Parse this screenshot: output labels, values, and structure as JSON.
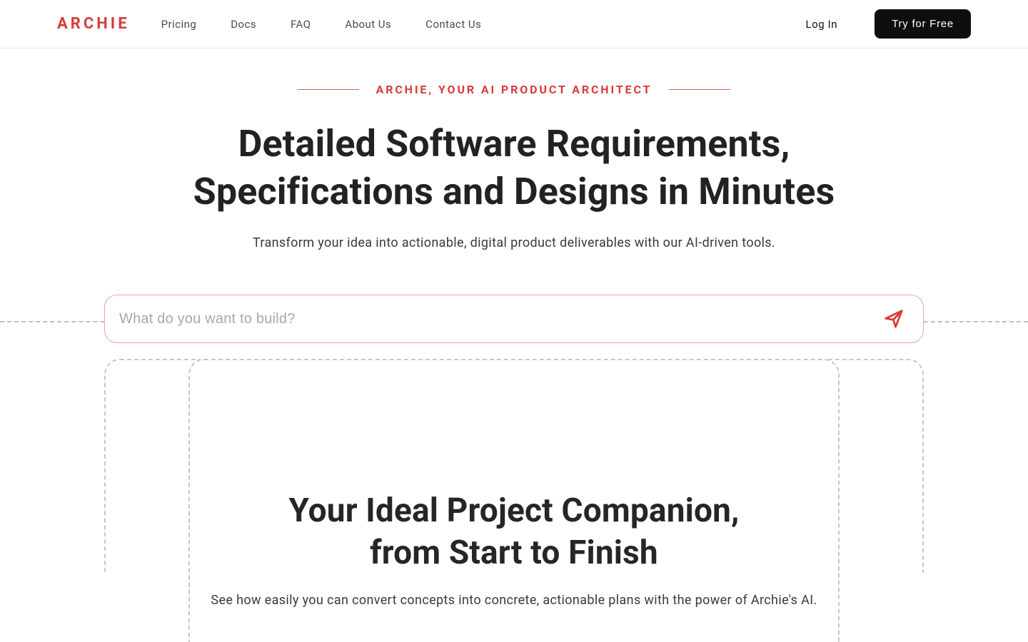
{
  "brand": "ARCHIE",
  "nav": {
    "items": [
      {
        "label": "Pricing"
      },
      {
        "label": "Docs"
      },
      {
        "label": "FAQ"
      },
      {
        "label": "About Us"
      },
      {
        "label": "Contact Us"
      }
    ]
  },
  "auth": {
    "login": "Log In",
    "cta": "Try for Free"
  },
  "hero": {
    "eyebrow": "ARCHIE, YOUR AI PRODUCT ARCHITECT",
    "headline_line1": "Detailed Software Requirements,",
    "headline_line2": "Specifications and Designs in Minutes",
    "subhead": "Transform your idea into actionable, digital product deliverables with our AI-driven tools."
  },
  "prompt": {
    "placeholder": "What do you want to build?",
    "value": ""
  },
  "section2": {
    "headline_line1": "Your Ideal Project Companion,",
    "headline_line2": "from Start to Finish",
    "subhead": "See how easily you can convert concepts into concrete, actionable plans with the power of Archie's AI."
  },
  "colors": {
    "brand": "#D83A3A",
    "cta_bg": "#0E0E0E"
  }
}
